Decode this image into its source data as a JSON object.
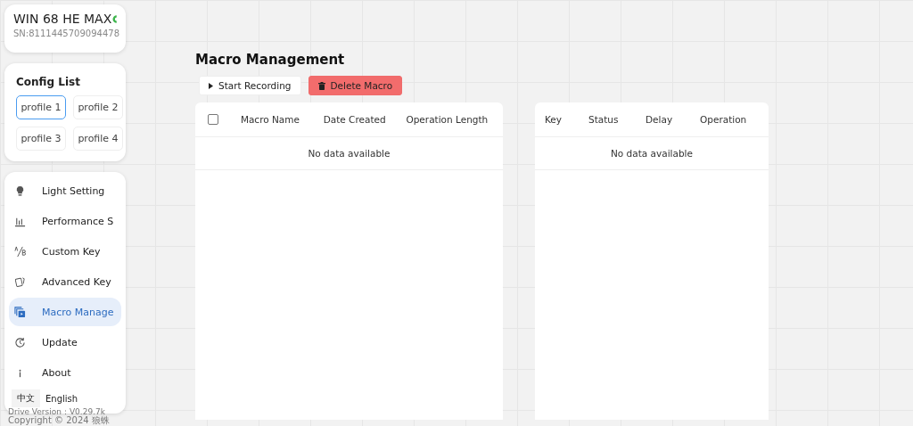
{
  "device": {
    "name": "WIN 68 HE MAX",
    "serial": "SN:8111445709094478",
    "connected": true
  },
  "config_list": {
    "title": "Config List",
    "profiles": [
      {
        "label": "profile 1",
        "selected": true
      },
      {
        "label": "profile 2",
        "selected": false
      },
      {
        "label": "profile 3",
        "selected": false
      },
      {
        "label": "profile 4",
        "selected": false
      }
    ]
  },
  "menu": [
    {
      "label": "Light Setting",
      "kind": "bulb",
      "selected": false
    },
    {
      "label": "Performance S",
      "kind": "bars",
      "selected": false
    },
    {
      "label": "Custom Key",
      "kind": "swap",
      "selected": false
    },
    {
      "label": "Advanced Key",
      "kind": "cards",
      "selected": false
    },
    {
      "label": "Macro Manage",
      "kind": "macro",
      "selected": true
    },
    {
      "label": "Update",
      "kind": "refresh",
      "selected": false
    },
    {
      "label": "About",
      "kind": "info",
      "selected": false
    }
  ],
  "language": [
    {
      "label": "中文",
      "selected": false
    },
    {
      "label": "English",
      "selected": true
    }
  ],
  "footer": {
    "version": "Drive Version：V0.29.7k",
    "copyright": "Copyright © 2024 狼蛛"
  },
  "page": {
    "title": "Macro Management",
    "buttons": [
      {
        "label": "Start Recording",
        "kind": "default"
      },
      {
        "label": "Delete Macro",
        "kind": "danger"
      }
    ],
    "macro_table": {
      "select_all": {
        "checked": false
      },
      "columns": [
        "Macro Name",
        "Date Created",
        "Operation Length"
      ],
      "empty": "No data available"
    },
    "step_table": {
      "columns": [
        "Key",
        "Status",
        "Delay",
        "Operation"
      ],
      "empty": "No data available"
    }
  }
}
